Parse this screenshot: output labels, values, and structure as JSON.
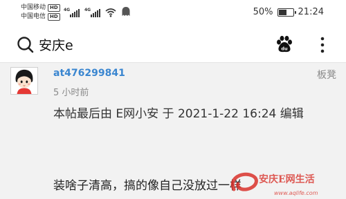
{
  "status_bar": {
    "carrier_1": "中国移动",
    "carrier_2": "中国电信",
    "hd_badge": "HD",
    "network_label": "4G",
    "battery_percent": "50%",
    "battery_level": 0.5,
    "time": "21:24"
  },
  "header": {
    "search_query": "安庆e"
  },
  "post": {
    "author": "at476299841",
    "time_ago": "5 小时前",
    "role": "板凳",
    "edit_note": "本帖最后由 E网小安 于 2021-1-22 16:24 编辑",
    "body": "装啥子清高，搞的像自己没放过一样"
  },
  "watermark": {
    "title": "安庆E网生活",
    "url": "www.aqlife.com"
  },
  "colors": {
    "author_link": "#3a86d0",
    "content_bg": "#f2f2f2",
    "watermark_red": "#d9322b"
  }
}
